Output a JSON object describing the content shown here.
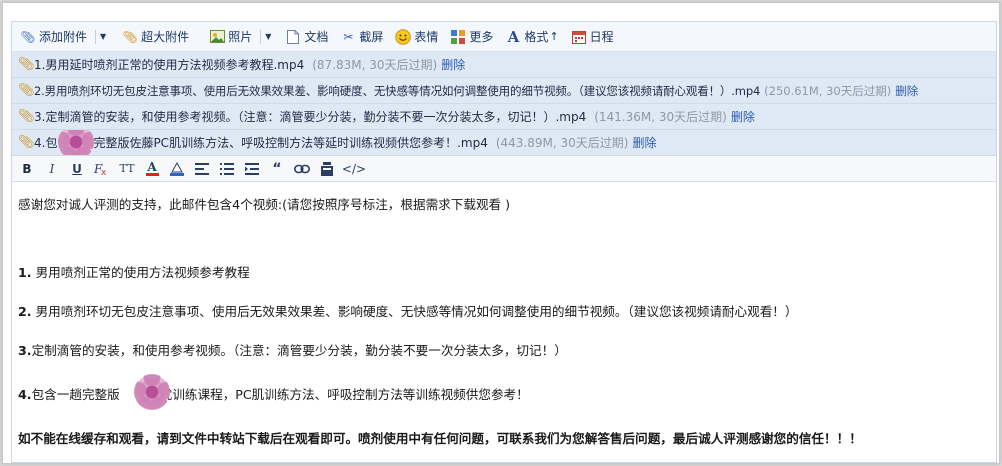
{
  "toolbar": {
    "add_attachment": "添加附件",
    "large_attachment": "超大附件",
    "photo": "照片",
    "document": "文档",
    "screenshot": "截屏",
    "emoji": "表情",
    "more": "更多",
    "format": "格式",
    "calendar": "日程"
  },
  "attachments": [
    {
      "name": "1.男用延时喷剂正常的使用方法视频参考教程.mp4",
      "meta": "(87.83M, 30天后过期)",
      "delete": "删除"
    },
    {
      "name": "2.男用喷剂环切无包皮注意事项、使用后无效果效果差、影响硬度、无快感等情况如何调整使用的细节视频。（建议您该视频请耐心观看！）.mp4",
      "meta": "(250.61M, 30天后过期)",
      "delete": "删除"
    },
    {
      "name": "3.定制滴管的安装，和使用参考视频。（注意：滴管要少分装，勤分装不要一次分装太多，切记！）.mp4",
      "meta": "(141.36M, 30天后过期)",
      "delete": "删除"
    },
    {
      "name": "4.包含一趟完整版佐藤PC肌训练方法、呼吸控制方法等延时训练视频供您参考！.mp4",
      "meta": "(443.89M, 30天后过期)",
      "delete": "删除"
    }
  ],
  "format_bar": {
    "bold": "B",
    "italic": "I",
    "underline": "U",
    "font_size": "TT",
    "font_color": "A",
    "html": "</>"
  },
  "body": {
    "line1": "感谢您对诚人评测的支持，此邮件包含4个视频:(请您按照序号标注，根据需求下载观看 )",
    "item1_num": "1.",
    "item1_text": " 男用喷剂正常的使用方法视频参考教程",
    "item2_num": "2.",
    "item2_text": " 男用喷剂环切无包皮注意事项、使用后无效果效果差、影响硬度、无快感等情况如何调整使用的细节视频。（建议您该视频请耐心观看！）",
    "item3_num": "3.",
    "item3_text": "定制滴管的安装，和使用参考视频。（注意：滴管要少分装，勤分装不要一次分装太多，切记！）",
    "item4_num": "4.",
    "item4_text_a": "包含一趟完整版",
    "item4_text_b": "优训练课程，PC肌训练方法、呼吸控制方法等训练视频供您参考！",
    "closing": "如不能在线缓存和观看，请到文件中转站下载后在观看即可。喷剂使用中有任何问题，可联系我们为您解答售后问题，最后诚人评测感谢您的信任！！！"
  },
  "colors": {
    "toolbar_bg": "#f4f7fb",
    "attachment_bg": "#dfe9f5",
    "link": "#2a5bb5",
    "meta": "#8d97a6"
  }
}
